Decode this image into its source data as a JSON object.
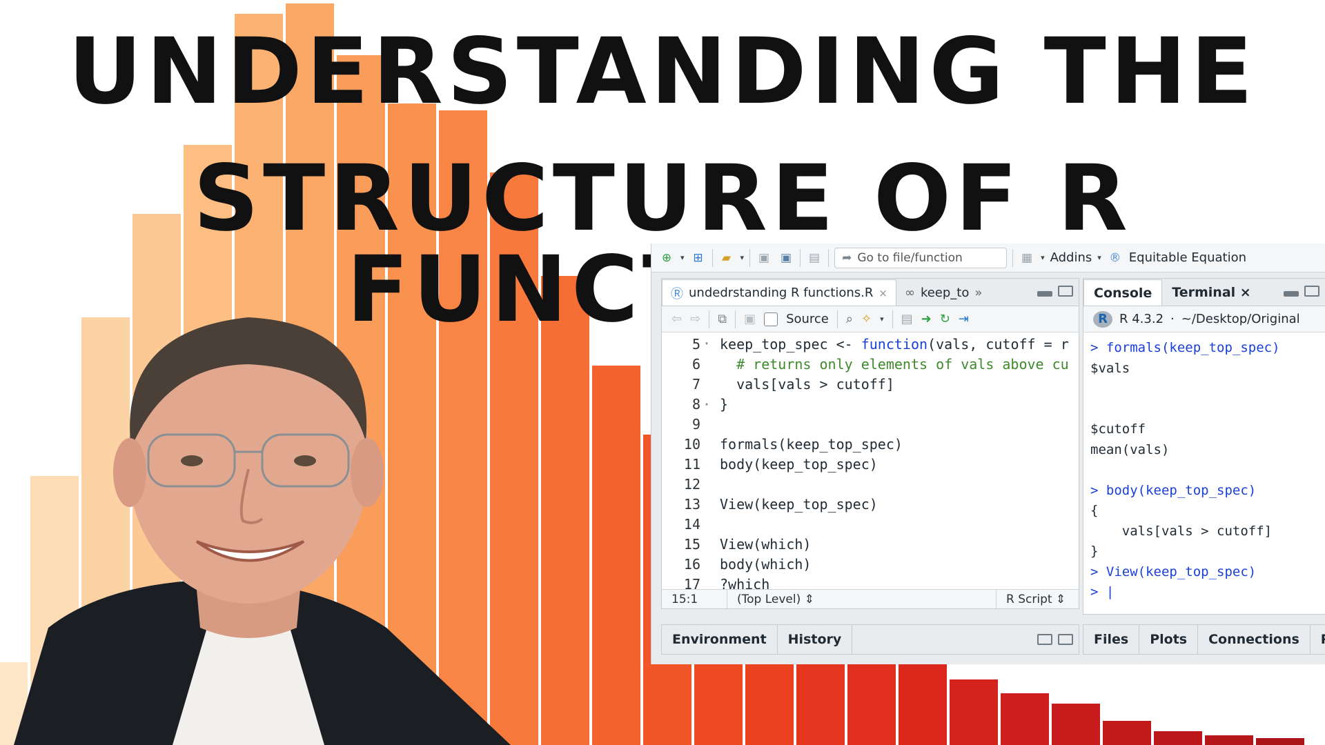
{
  "title": {
    "line1": "UNDERSTANDING THE",
    "line2": "STRUCTURE OF R FUNCTIONS"
  },
  "colors": {
    "bar_palette_light": "#fde8c8",
    "bar_palette_mid": "#f99a4f",
    "bar_palette_dark": "#d11f1f",
    "keyword_blue": "#1a3fd9",
    "comment_green": "#3e8a2b"
  },
  "toolbar": {
    "goto_placeholder": "Go to file/function",
    "addins_label": "Addins",
    "equatable_label": "Equitable Equation"
  },
  "source": {
    "tabs": [
      {
        "label": "undedrstanding R functions.R",
        "active": true
      },
      {
        "label": "keep_to",
        "active": false
      }
    ],
    "source_label": "Source",
    "lines": [
      {
        "n": "5",
        "fold": "▾",
        "code": [
          {
            "t": "keep_top_spec <- ",
            "c": ""
          },
          {
            "t": "function",
            "c": "kw"
          },
          {
            "t": "(vals, cutoff = r",
            "c": ""
          }
        ]
      },
      {
        "n": "6",
        "fold": "",
        "code": [
          {
            "t": "  # returns only elements of vals above cu",
            "c": "cm"
          }
        ]
      },
      {
        "n": "7",
        "fold": "",
        "code": [
          {
            "t": "  vals[vals > cutoff]",
            "c": ""
          }
        ]
      },
      {
        "n": "8",
        "fold": "▴",
        "code": [
          {
            "t": "}",
            "c": ""
          }
        ]
      },
      {
        "n": "9",
        "fold": "",
        "code": [
          {
            "t": "",
            "c": ""
          }
        ]
      },
      {
        "n": "10",
        "fold": "",
        "code": [
          {
            "t": "formals(keep_top_spec)",
            "c": ""
          }
        ]
      },
      {
        "n": "11",
        "fold": "",
        "code": [
          {
            "t": "body(keep_top_spec)",
            "c": ""
          }
        ]
      },
      {
        "n": "12",
        "fold": "",
        "code": [
          {
            "t": "",
            "c": ""
          }
        ]
      },
      {
        "n": "13",
        "fold": "",
        "code": [
          {
            "t": "View(keep_top_spec)",
            "c": ""
          }
        ]
      },
      {
        "n": "14",
        "fold": "",
        "code": [
          {
            "t": "",
            "c": ""
          }
        ]
      },
      {
        "n": "15",
        "fold": "",
        "code": [
          {
            "t": "View(which)",
            "c": ""
          }
        ]
      },
      {
        "n": "16",
        "fold": "",
        "code": [
          {
            "t": "body(which)",
            "c": ""
          }
        ]
      },
      {
        "n": "17",
        "fold": "",
        "code": [
          {
            "t": "?which",
            "c": ""
          }
        ]
      }
    ],
    "status": {
      "position": "15:1",
      "scope": "(Top Level) ⇕",
      "filetype": "R Script ⇕"
    }
  },
  "console": {
    "tabs": [
      {
        "label": "Console",
        "active": true
      },
      {
        "label": "Terminal ×",
        "active": false
      }
    ],
    "version": "R 4.3.2",
    "path": "~/Desktop/Original",
    "lines": [
      {
        "t": "> formals(keep_top_spec)",
        "c": "cin"
      },
      {
        "t": "$vals",
        "c": "cout"
      },
      {
        "t": "",
        "c": "cout"
      },
      {
        "t": "",
        "c": "cout"
      },
      {
        "t": "$cutoff",
        "c": "cout"
      },
      {
        "t": "mean(vals)",
        "c": "cout"
      },
      {
        "t": "",
        "c": "cout"
      },
      {
        "t": "> body(keep_top_spec)",
        "c": "cin"
      },
      {
        "t": "{",
        "c": "cout"
      },
      {
        "t": "    vals[vals > cutoff]",
        "c": "cout"
      },
      {
        "t": "}",
        "c": "cout"
      },
      {
        "t": "> View(keep_top_spec)",
        "c": "cin"
      },
      {
        "t": "> |",
        "c": "cin"
      }
    ]
  },
  "bottom_left_tabs": [
    "Environment",
    "History"
  ],
  "bottom_right_tabs": [
    "Files",
    "Plots",
    "Connections",
    "Pa"
  ]
}
